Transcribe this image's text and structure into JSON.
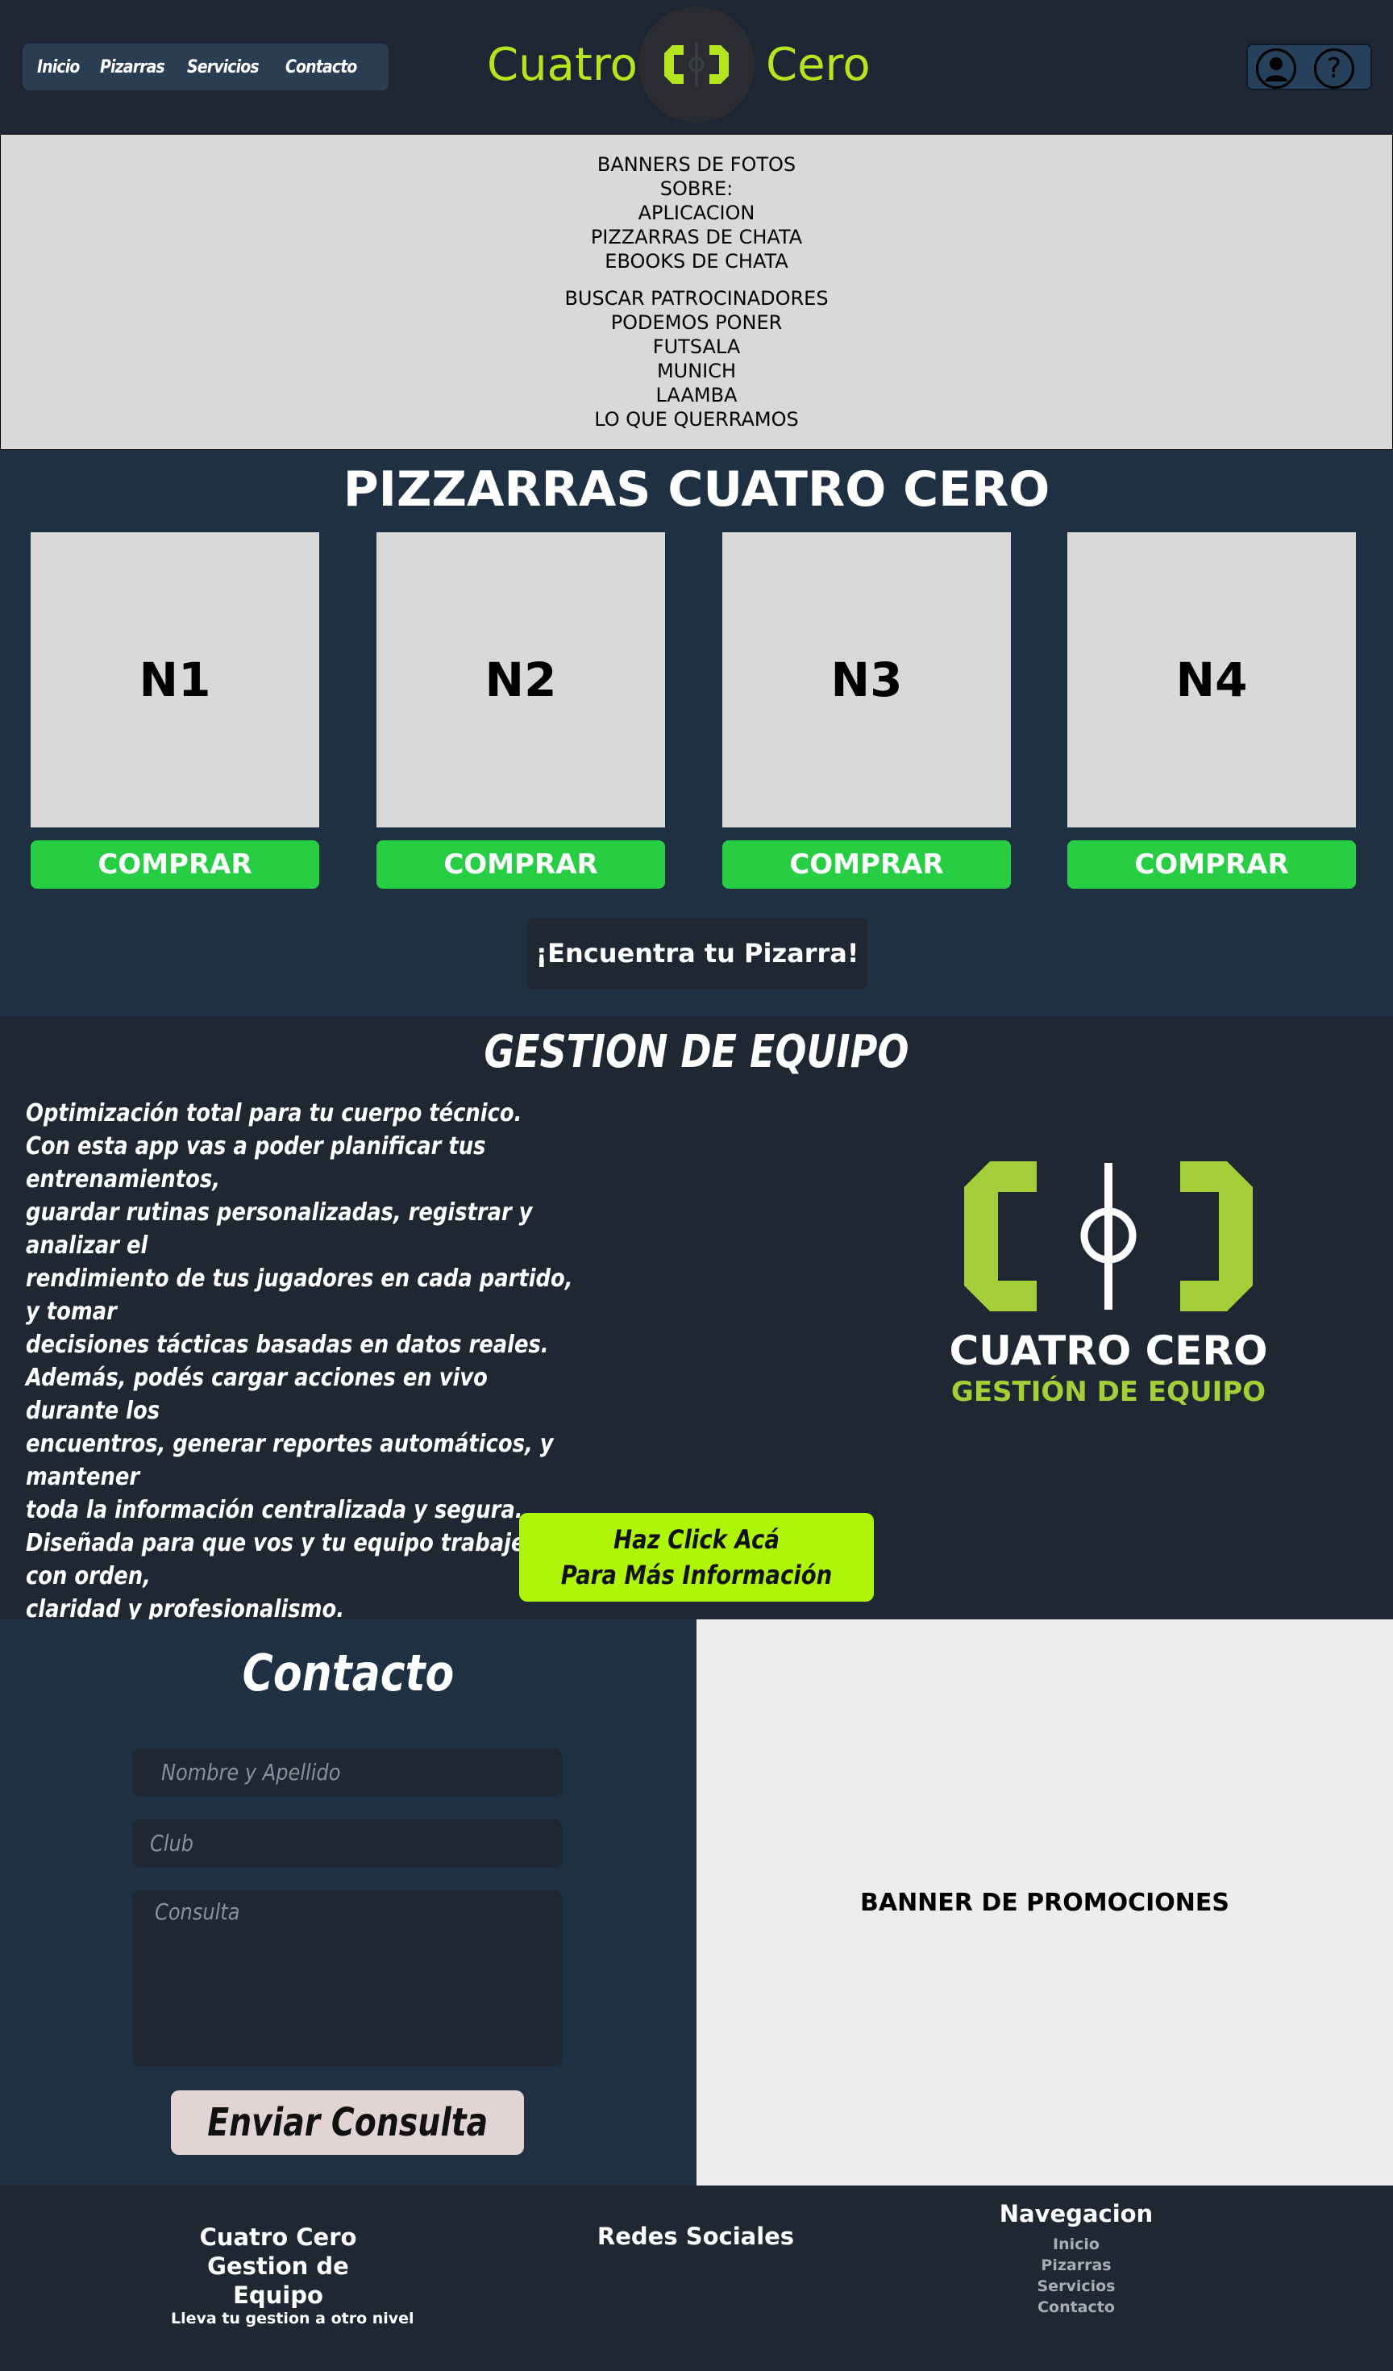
{
  "header": {
    "nav": [
      "Inicio",
      "Pizarras",
      "Servicios",
      "Contacto"
    ],
    "brand_left": "Cuatro",
    "brand_right": "Cero",
    "icons": [
      "user-icon",
      "help-icon"
    ],
    "brand_color": "#b5e61d"
  },
  "banner": {
    "lines_a": [
      "BANNERS DE FOTOS",
      "SOBRE:",
      "APLICACION",
      "PIZZARRAS DE CHATA",
      "EBOOKS DE CHATA"
    ],
    "lines_b": [
      "BUSCAR PATROCINADORES",
      "PODEMOS PONER",
      "FUTSALA",
      "MUNICH",
      "LAAMBA",
      "LO QUE QUERRAMOS"
    ]
  },
  "pizarras": {
    "title": "PIZZARRAS CUATRO CERO",
    "cards": [
      "N1",
      "N2",
      "N3",
      "N4"
    ],
    "buy_label": "COMPRAR",
    "find_label": "¡Encuentra tu Pizarra!",
    "buy_color": "#27cd43"
  },
  "gestion": {
    "title": "GESTION DE EQUIPO",
    "text": "Optimización total para tu cuerpo técnico.\n Con esta app vas a poder planificar tus entrenamientos,\nguardar rutinas personalizadas, registrar y analizar el\nrendimiento de tus jugadores en cada partido, y tomar\ndecisiones tácticas basadas en datos reales.\n Además, podés cargar acciones en vivo durante los\nencuentros, generar reportes automáticos, y mantener\ntoda la información centralizada y segura.\n Diseñada para que vos y tu equipo trabajen con orden,\nclaridad y profesionalismo.",
    "logo_line1": "CUATRO CERO",
    "logo_line2": "GESTIÓN DE EQUIPO",
    "more_line1": "Haz Click Acá",
    "more_line2": "Para Más Información",
    "accent": "#aef508",
    "logo_green": "#a4cf38"
  },
  "contact": {
    "title": "Contacto",
    "name_placeholder": "Nombre y Apellido",
    "club_placeholder": "Club",
    "query_placeholder": "Consulta",
    "send_label": "Enviar Consulta"
  },
  "promo": {
    "label": "BANNER DE PROMOCIONES"
  },
  "footer": {
    "brand_line1": "Cuatro Cero",
    "brand_line2": "Gestion de Equipo",
    "tagline": "Lleva tu gestion a otro nivel",
    "social_title": "Redes Sociales",
    "nav_title": "Navegacion",
    "nav_links": [
      "Inicio",
      "Pizarras",
      "Servicios",
      "Contacto"
    ]
  }
}
